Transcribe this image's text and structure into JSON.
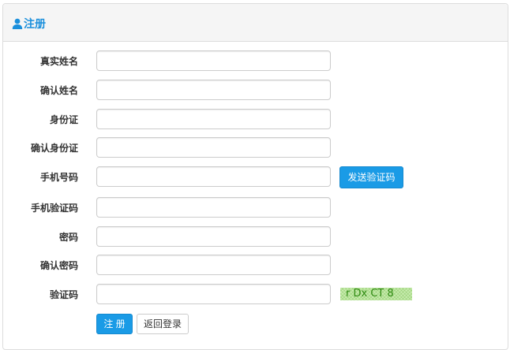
{
  "panel": {
    "title": "注册",
    "title_icon": "user-icon",
    "accent_color": "#1a8fdc"
  },
  "form": {
    "fields": [
      {
        "label": "真实姓名",
        "value": "",
        "placeholder": ""
      },
      {
        "label": "确认姓名",
        "value": "",
        "placeholder": ""
      },
      {
        "label": "身份证",
        "value": "",
        "placeholder": ""
      },
      {
        "label": "确认身份证",
        "value": "",
        "placeholder": ""
      },
      {
        "label": "手机号码",
        "value": "",
        "placeholder": ""
      },
      {
        "label": "手机验证码",
        "value": "",
        "placeholder": ""
      },
      {
        "label": "密码",
        "value": "",
        "placeholder": ""
      },
      {
        "label": "确认密码",
        "value": "",
        "placeholder": ""
      },
      {
        "label": "验证码",
        "value": "",
        "placeholder": ""
      }
    ],
    "send_code_button": "发送验证码",
    "captcha_text": "r Dx CT 8",
    "register_button": "注 册",
    "back_login_button": "返回登录"
  },
  "colors": {
    "primary_button": "#1a9be6",
    "captcha_bg": "#c9ecb0",
    "captcha_text": "#2f8a12"
  }
}
